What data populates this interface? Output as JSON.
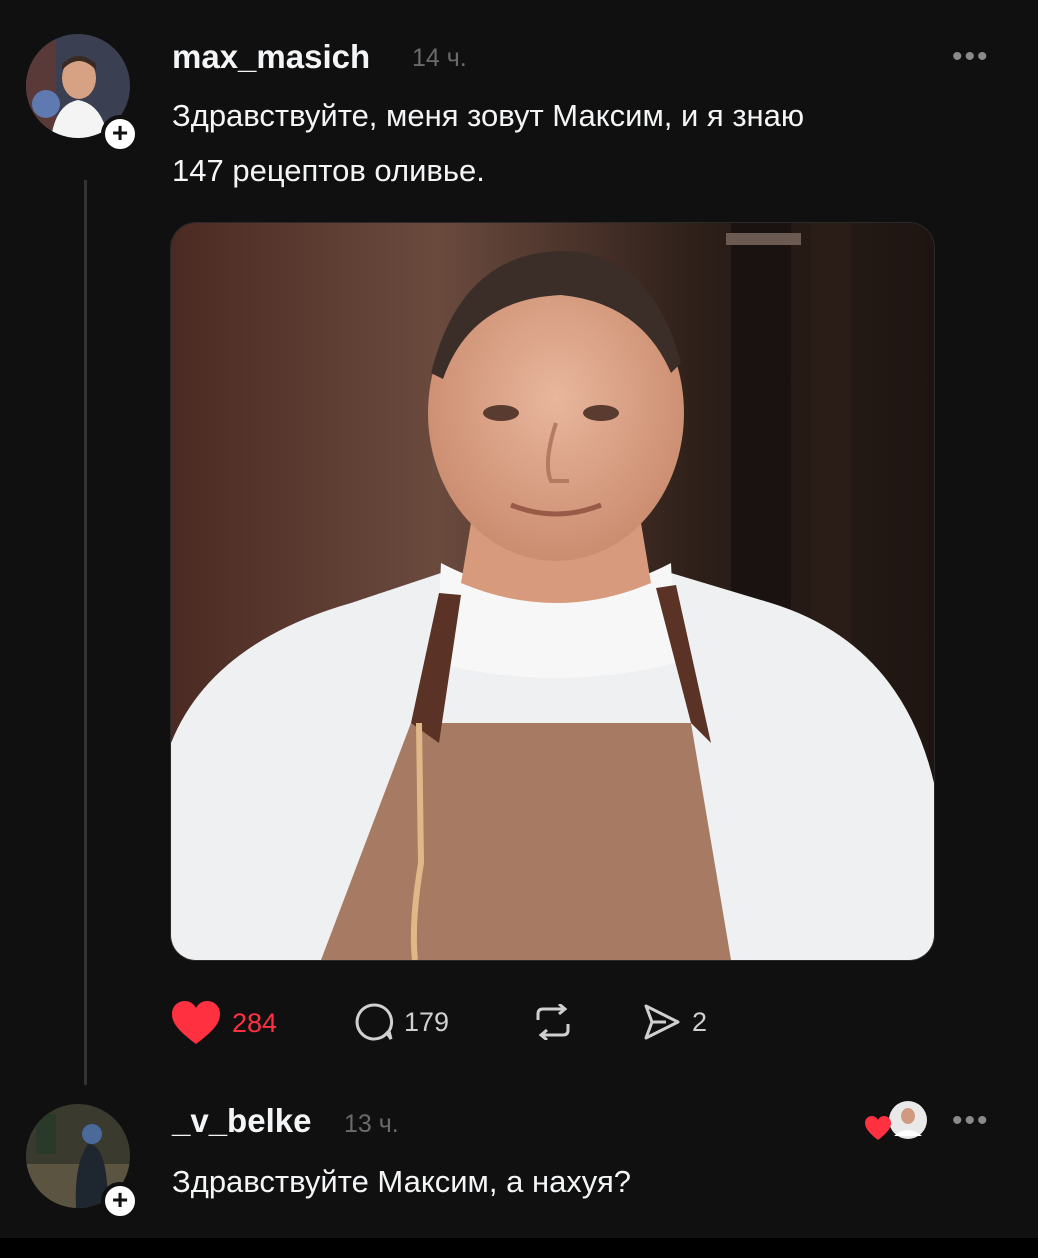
{
  "post": {
    "username": "max_masich",
    "time": "14 ч.",
    "more": "•••",
    "text_line1": "Здравствуйте, меня зовут Максим, и я знаю",
    "text_line2": "147 рецептов оливье.",
    "actions": {
      "likes": "284",
      "comments": "179",
      "reposts": "",
      "shares": "2"
    },
    "follow_symbol": "+"
  },
  "reply": {
    "username": "_v_belke",
    "time": "13 ч.",
    "more": "•••",
    "text": "Здравствуйте Максим, а нахуя?",
    "follow_symbol": "+"
  },
  "colors": {
    "background": "#101010",
    "like": "#ff3040",
    "text": "#f3f5f7",
    "muted": "#6a6a6a"
  },
  "icons": {
    "like": "heart-icon",
    "comment": "comment-bubble-icon",
    "repost": "repost-icon",
    "share": "send-icon",
    "follow": "plus-icon",
    "more": "more-icon"
  }
}
